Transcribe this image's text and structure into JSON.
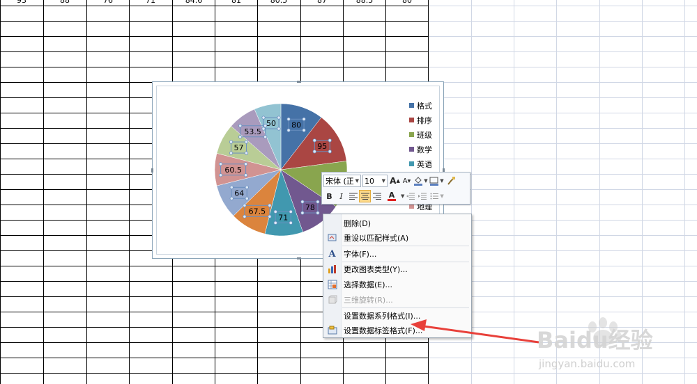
{
  "spreadsheet": {
    "top_row_values": [
      "93",
      "88",
      "76",
      "71",
      "84.6",
      "81",
      "80.5",
      "87",
      "88.5",
      "80"
    ]
  },
  "chart": {
    "colors": {
      "bg": "#ffffff",
      "s1": "#4572a7",
      "s2": "#aa4643",
      "s3": "#89a54e",
      "s4": "#71588f",
      "s5": "#4198af",
      "s6": "#db843d",
      "s7": "#93a9cf",
      "s8": "#d19392",
      "s9": "#b9cd96",
      "s10": "#a99bbd",
      "s11": "#92c3d2"
    },
    "legend": [
      {
        "label": "格式",
        "color": "#4572a7"
      },
      {
        "label": "排序",
        "color": "#aa4643"
      },
      {
        "label": "班级",
        "color": "#89a54e"
      },
      {
        "label": "数学",
        "color": "#71588f"
      },
      {
        "label": "英语",
        "color": "#4198af"
      },
      {
        "label": "地理",
        "color": "#d19392"
      }
    ]
  },
  "chart_data": {
    "type": "pie",
    "categories": [
      "格式",
      "排序",
      "班级",
      "数学",
      "英语",
      "",
      "",
      "地理",
      "",
      "",
      ""
    ],
    "values": [
      80,
      95,
      88,
      78,
      71,
      67.5,
      64,
      60.5,
      57,
      53.5,
      50
    ],
    "data_labels": [
      "80",
      "95",
      "",
      "78",
      "71",
      "67.5",
      "64",
      "60.5",
      "57",
      "53.5",
      "50"
    ],
    "colors": [
      "#4572a7",
      "#aa4643",
      "#89a54e",
      "#71588f",
      "#4198af",
      "#db843d",
      "#93a9cf",
      "#d19392",
      "#b9cd96",
      "#a99bbd",
      "#92c3d2"
    ],
    "legend_position": "right"
  },
  "mini_toolbar": {
    "font_name": "宋体 (正",
    "font_size": "10",
    "grow_font": "A",
    "shrink_font": "A",
    "bold": "B",
    "italic": "I",
    "font_color": "A"
  },
  "context_menu": {
    "items": [
      {
        "label": "删除(D)",
        "icon": "none",
        "enabled": true
      },
      {
        "label": "重设以匹配样式(A)",
        "icon": "reset-style-icon",
        "enabled": true
      },
      {
        "label": "字体(F)...",
        "icon": "font-icon",
        "enabled": true
      },
      {
        "label": "更改图表类型(Y)...",
        "icon": "chart-type-icon",
        "enabled": true
      },
      {
        "label": "选择数据(E)...",
        "icon": "select-data-icon",
        "enabled": true
      },
      {
        "label": "三维旋转(R)...",
        "icon": "rotate-3d-icon",
        "enabled": false
      },
      {
        "label": "设置数据系列格式(I)...",
        "icon": "none",
        "enabled": true
      },
      {
        "label": "设置数据标签格式(F)...",
        "icon": "format-labels-icon",
        "enabled": true
      }
    ]
  },
  "annotation": {
    "arrow_color": "#e8403a"
  },
  "watermark": {
    "brand": "Baidu经验",
    "url": "jingyan.baidu.com"
  }
}
